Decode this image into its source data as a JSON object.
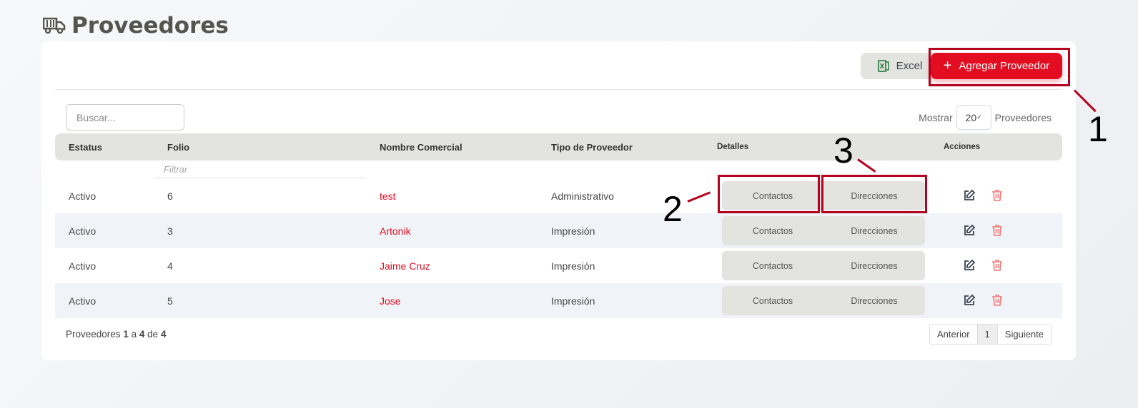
{
  "page": {
    "title": "Proveedores",
    "icon": "truck-icon"
  },
  "toolbar": {
    "excel_label": "Excel",
    "add_label": "Agregar Proveedor"
  },
  "search": {
    "placeholder": "Buscar..."
  },
  "page_size": {
    "prefix": "Mostrar",
    "value": "20",
    "suffix": "Proveedores"
  },
  "table": {
    "headers": [
      "Estatus",
      "Folio",
      "Nombre Comercial",
      "Tipo de Proveedor",
      "Detalles",
      "Acciones"
    ],
    "filter_placeholder": "Filtrar",
    "details_buttons": [
      "Contactos",
      "Direcciones"
    ],
    "rows": [
      {
        "status": "Activo",
        "folio": "6",
        "name": "test",
        "type": "Administrativo"
      },
      {
        "status": "Activo",
        "folio": "3",
        "name": "Artonik",
        "type": "Impresión"
      },
      {
        "status": "Activo",
        "folio": "4",
        "name": "Jaime Cruz",
        "type": "Impresión"
      },
      {
        "status": "Activo",
        "folio": "5",
        "name": "Jose",
        "type": "Impresión"
      }
    ]
  },
  "footer": {
    "prefix": "Proveedores",
    "from": "1",
    "a": "a",
    "to": "4",
    "de": "de",
    "total": "4"
  },
  "pagination": {
    "prev": "Anterior",
    "current": "1",
    "next": "Siguiente"
  },
  "annotations": [
    "1",
    "2",
    "3"
  ],
  "colors": {
    "accent": "#e30d22",
    "annotation": "#b5001e"
  }
}
